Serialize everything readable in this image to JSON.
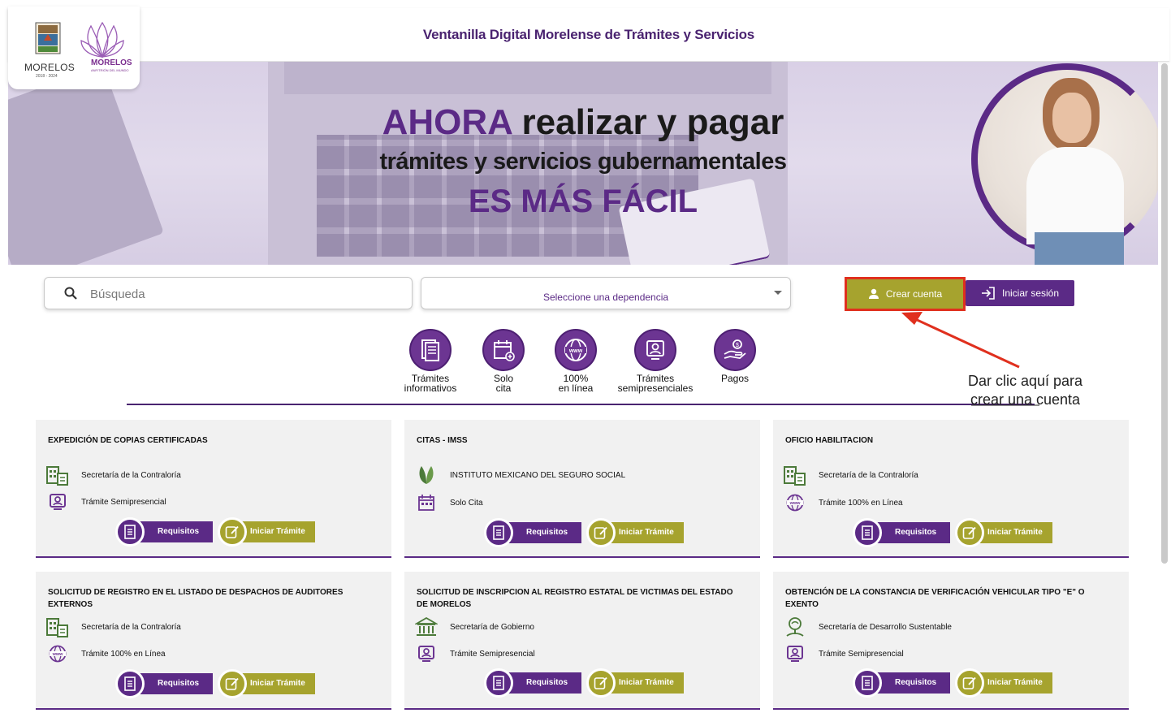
{
  "header": {
    "title": "Ventanilla Digital Morelense de Trámites y Servicios",
    "logo_left_name": "MORELOS",
    "logo_left_years": "2018 - 2024",
    "logo_right_name": "MORELOS",
    "logo_right_tagline": "ANFITRIÓN DEL MUNDO"
  },
  "hero": {
    "line1_accent": "AHORA",
    "line1_rest": " realizar y pagar",
    "line2": "trámites y servicios gubernamentales",
    "line3": "ES MÁS FÁCIL"
  },
  "search": {
    "placeholder": "Búsqueda",
    "value": ""
  },
  "dependency_select": {
    "selected": "Seleccione una dependencia"
  },
  "auth": {
    "create_account": "Crear cuenta",
    "login": "Iniciar sesión"
  },
  "categories": [
    {
      "label1": "Trámites",
      "label2": "informativos",
      "icon": "document-icon"
    },
    {
      "label1": "Solo",
      "label2": "cita",
      "icon": "calendar-icon"
    },
    {
      "label1": "100%",
      "label2": "en línea",
      "icon": "globe-www-icon"
    },
    {
      "label1": "Trámites",
      "label2": "semipresenciales",
      "icon": "person-screen-icon"
    },
    {
      "label1": "Pagos",
      "label2": "",
      "icon": "hand-coin-icon"
    }
  ],
  "annotation": {
    "line1": "Dar clic aquí para",
    "line2": "crear una cuenta",
    "color": "#e0301e"
  },
  "cards": [
    {
      "title": "EXPEDICIÓN DE COPIAS CERTIFICADAS",
      "dependency": "Secretaría de la Contraloría",
      "dep_icon": "building-doc-icon",
      "type": "Trámite Semipresencial",
      "type_icon": "person-screen-icon"
    },
    {
      "title": "CITAS - IMSS",
      "dependency": "INSTITUTO MEXICANO DEL SEGURO SOCIAL",
      "dep_icon": "leaf-icon",
      "type": "Solo Cita",
      "type_icon": "calendar-icon"
    },
    {
      "title": "OFICIO HABILITACION",
      "dependency": "Secretaría de la Contraloría",
      "dep_icon": "building-doc-icon",
      "type": "Trámite 100% en Línea",
      "type_icon": "globe-www-icon"
    },
    {
      "title": "SOLICITUD DE REGISTRO EN EL LISTADO DE DESPACHOS DE AUDITORES EXTERNOS",
      "dependency": "Secretaría de la Contraloría",
      "dep_icon": "building-doc-icon",
      "type": "Trámite 100% en Línea",
      "type_icon": "globe-www-icon"
    },
    {
      "title": "SOLICITUD DE INSCRIPCION AL REGISTRO ESTATAL DE VICTIMAS DEL ESTADO DE MORELOS",
      "dependency": "Secretaría de Gobierno",
      "dep_icon": "government-building-icon",
      "type": "Trámite Semipresencial",
      "type_icon": "person-screen-icon"
    },
    {
      "title": "OBTENCIÓN DE LA CONSTANCIA DE VERIFICACIÓN VEHICULAR TIPO \"E\" O EXENTO",
      "dependency": "Secretaría de Desarrollo Sustentable",
      "dep_icon": "tree-icon",
      "type": "Trámite Semipresencial",
      "type_icon": "person-screen-icon"
    }
  ],
  "card_buttons": {
    "requirements": "Requisitos",
    "start": "Iniciar Trámite"
  },
  "colors": {
    "purple": "#5b2a86",
    "olive": "#a6a32e",
    "highlight_red": "#e0301e"
  }
}
